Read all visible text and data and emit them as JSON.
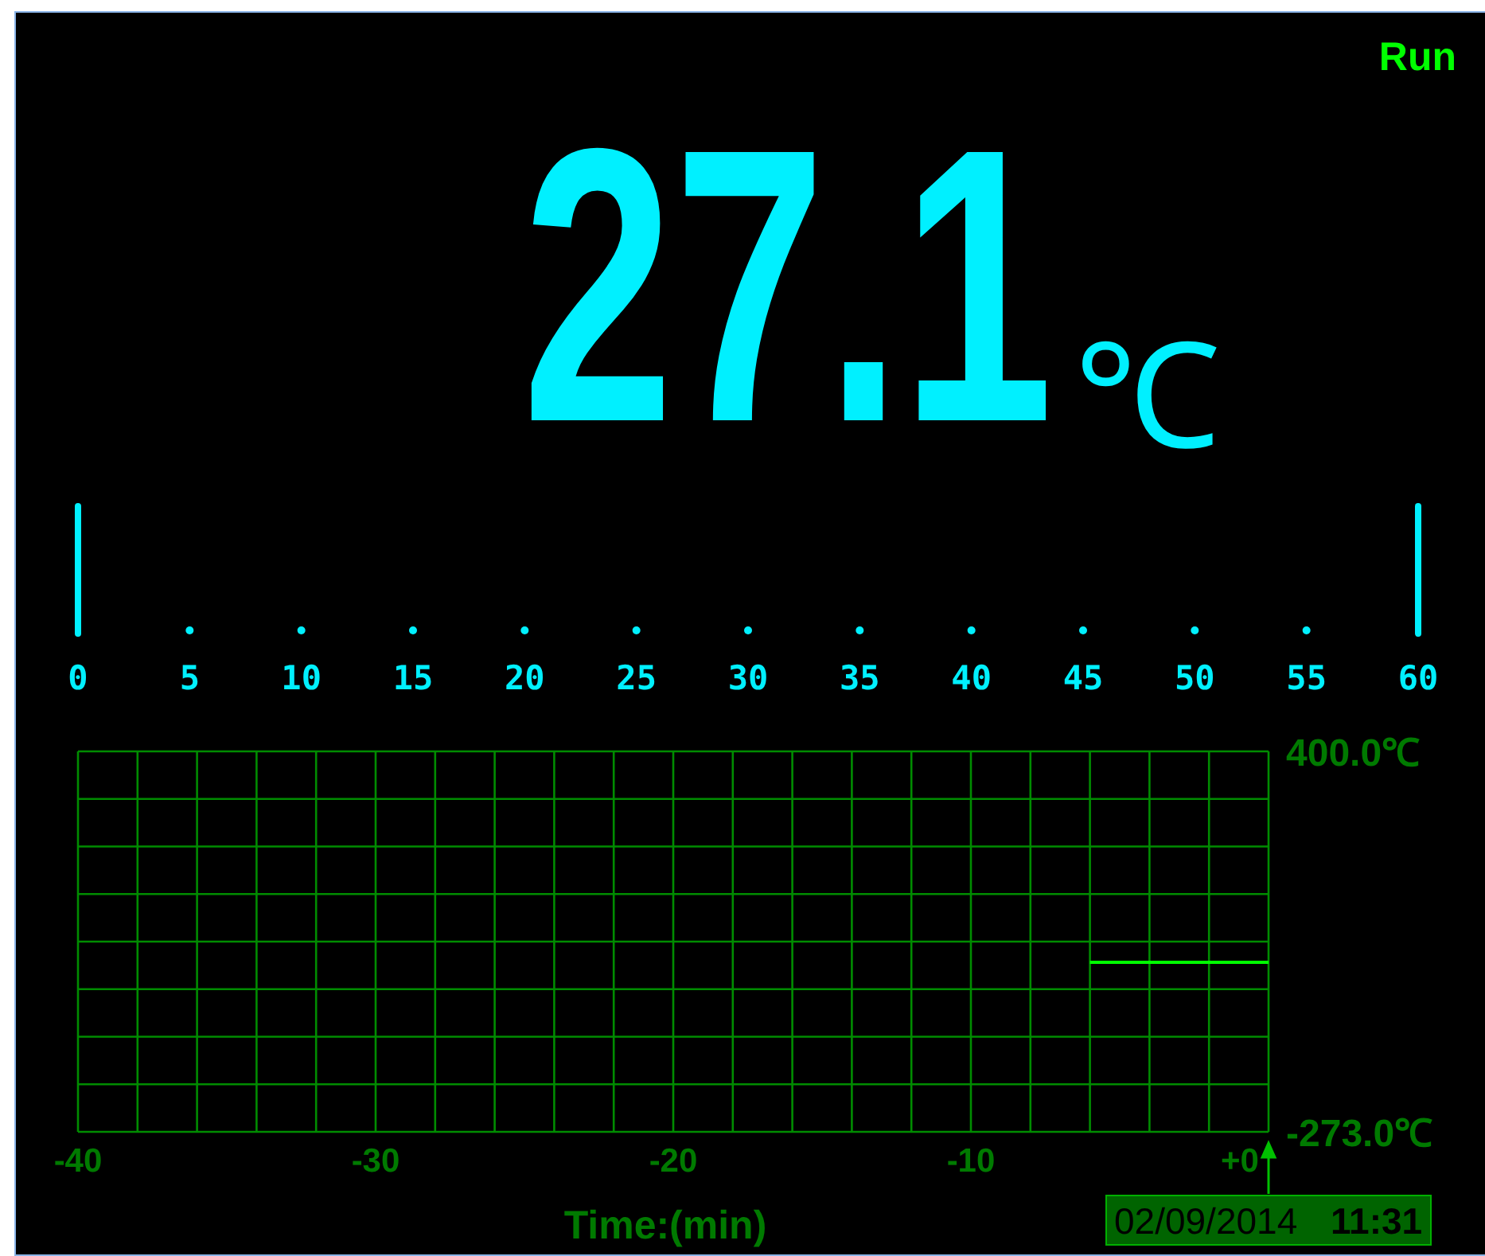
{
  "status": "Run",
  "reading": {
    "value": "27.1",
    "unit": "℃"
  },
  "scale": {
    "labels": [
      "0",
      "5",
      "10",
      "15",
      "20",
      "25",
      "30",
      "35",
      "40",
      "45",
      "50",
      "55",
      "60"
    ]
  },
  "trend": {
    "chart_data": {
      "type": "line",
      "xlabel": "Time:(min)",
      "x": [
        -6,
        0
      ],
      "series": [
        {
          "color": "#00ff00",
          "values": [
            27,
            27
          ]
        }
      ],
      "grid": true,
      "xlim": [
        -40,
        0
      ],
      "ylim": [
        -273,
        400
      ],
      "xticks": [
        {
          "value": -40,
          "label": "-40"
        },
        {
          "value": -30,
          "label": "-30"
        },
        {
          "value": -20,
          "label": "-20"
        },
        {
          "value": -10,
          "label": "-10"
        },
        {
          "value": 0,
          "label": "+0"
        }
      ],
      "yticks": [
        {
          "value": 400,
          "label": "400.0℃"
        },
        {
          "value": -273,
          "label": "-273.0℃"
        }
      ]
    },
    "date": "02/09/2014",
    "time": "11:31"
  }
}
